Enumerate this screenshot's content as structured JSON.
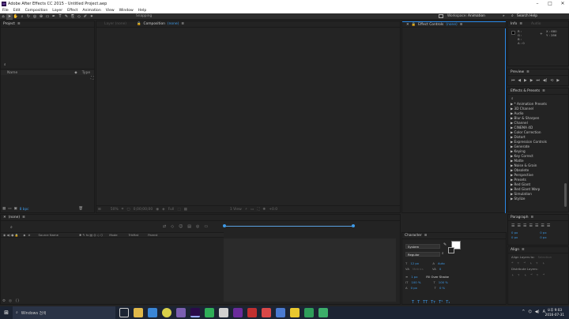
{
  "window": {
    "title": "Adobe After Effects CC 2015 - Untitled Project.aep",
    "controls": [
      "–",
      "□",
      "✕"
    ]
  },
  "menu": [
    "File",
    "Edit",
    "Composition",
    "Layer",
    "Effect",
    "Animation",
    "View",
    "Window",
    "Help"
  ],
  "toolbar": {
    "snapping_label": "Snapping",
    "workspace_label": "Workspace:",
    "workspace_value": "Animation",
    "search_placeholder": "Search Help"
  },
  "project": {
    "title": "Project",
    "columns": {
      "name": "Name",
      "type": "Type"
    },
    "bpc": "8 bpc"
  },
  "viewer": {
    "layer_tab": "Layer (none)",
    "comp_tab_prefix": "Composition",
    "comp_tab_value": "(none)",
    "zoom": "50%",
    "timecode": "0;00;00;00",
    "resolution": "Full",
    "views": "1 View",
    "exposure": "+0.0"
  },
  "effect_controls": {
    "title_prefix": "Effect Controls",
    "title_value": "(none)"
  },
  "info": {
    "tab_info": "Info",
    "tab_audio": "Audio",
    "r": "R :",
    "g": "G :",
    "b": "B :",
    "a": "A : 0",
    "x": "X : 680",
    "y": "Y : 286"
  },
  "preview": {
    "title": "Preview"
  },
  "effects_presets": {
    "title": "Effects & Presets",
    "items": [
      "▶ * Animation Presets",
      "▶ 3D Channel",
      "▶ Audio",
      "▶ Blur & Sharpen",
      "▶ Channel",
      "▶ CINEMA 4D",
      "▶ Color Correction",
      "▶ Distort",
      "▶ Expression Controls",
      "▶ Generate",
      "▶ Keying",
      "▶ Key Correct",
      "▶ Matte",
      "▶ Noise & Grain",
      "▶ Obsolete",
      "▶ Perspective",
      "▶ Presets",
      "▶ Red Giant",
      "▶ Red Giant Warp",
      "▶ Simulation",
      "▶ Stylize"
    ]
  },
  "paragraph": {
    "title": "Paragraph",
    "indent_left": "0 px",
    "indent_right": "0 px",
    "space_before": "0 px",
    "space_after": "0 px"
  },
  "align": {
    "title": "Align",
    "align_to_label": "Align Layers to:",
    "align_to_value": "Selection",
    "distribute_label": "Distribute Layers:"
  },
  "character": {
    "title": "Character",
    "font": "System",
    "style": "Regular",
    "size": "12 px",
    "leading": "Auto",
    "kerning": "Metrics",
    "tracking": "0",
    "stroke_width": "1 px",
    "stroke_type": "Fill Over Stroke",
    "vscale": "100 %",
    "hscale": "100 %",
    "baseline": "0 px",
    "tsume": "0 %"
  },
  "timeline": {
    "tab": "(none)",
    "columns": {
      "source_name": "Source Name",
      "mode": "Mode",
      "trkmat": "TrkMat",
      "parent": "Parent"
    }
  },
  "taskbar": {
    "search_placeholder": "Windows 검색",
    "time": "오후 9:03",
    "date": "2016-07-31"
  },
  "colors": {
    "accent": "#2d8ceb",
    "panel_bg": "#232323",
    "taskbar_bg": "#1c2433",
    "ae_purple": "#2a0a4a"
  }
}
